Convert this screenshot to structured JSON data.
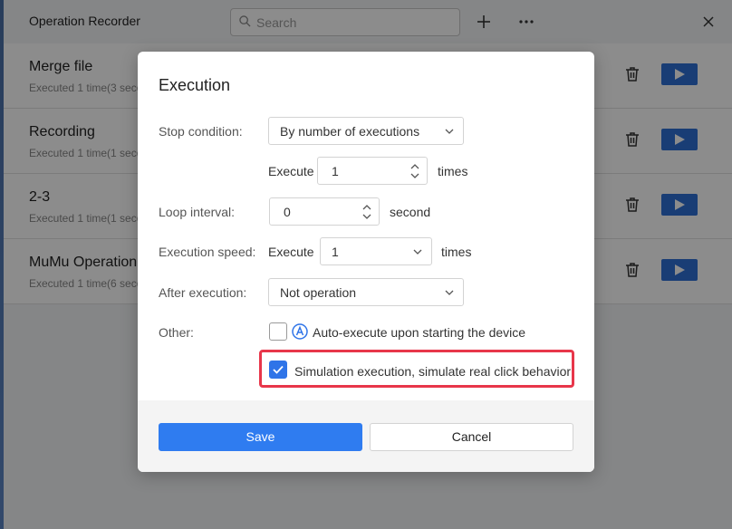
{
  "app": {
    "title": "Operation Recorder",
    "search_placeholder": "Search",
    "records": [
      {
        "name": "Merge file",
        "meta": "Executed 1 time(3 seco"
      },
      {
        "name": "Recording",
        "meta": "Executed 1 time(1 seco"
      },
      {
        "name": "2-3",
        "meta": "Executed 1 time(1 seco"
      },
      {
        "name": "MuMu Operation",
        "meta": "Executed 1 time(6 seco"
      }
    ]
  },
  "dialog": {
    "title": "Execution",
    "stop_condition": {
      "label": "Stop condition:",
      "value": "By number of executions"
    },
    "execute_count": {
      "label": "Execute",
      "value": "1",
      "unit": "times"
    },
    "loop_interval": {
      "label": "Loop interval:",
      "value": "0",
      "unit": "second"
    },
    "execution_speed": {
      "label": "Execution speed:",
      "prefix": "Execute",
      "value": "1",
      "unit": "times"
    },
    "after_execution": {
      "label": "After execution:",
      "value": "Not operation"
    },
    "other": {
      "label": "Other:",
      "auto_execute": {
        "label": "Auto-execute upon starting the device",
        "checked": false
      },
      "simulation": {
        "label": "Simulation execution, simulate real click behavior",
        "checked": true
      }
    },
    "save_label": "Save",
    "cancel_label": "Cancel"
  },
  "colors": {
    "accent": "#2f7cf0",
    "highlight": "#e8364a",
    "play": "#2e6fd6"
  }
}
